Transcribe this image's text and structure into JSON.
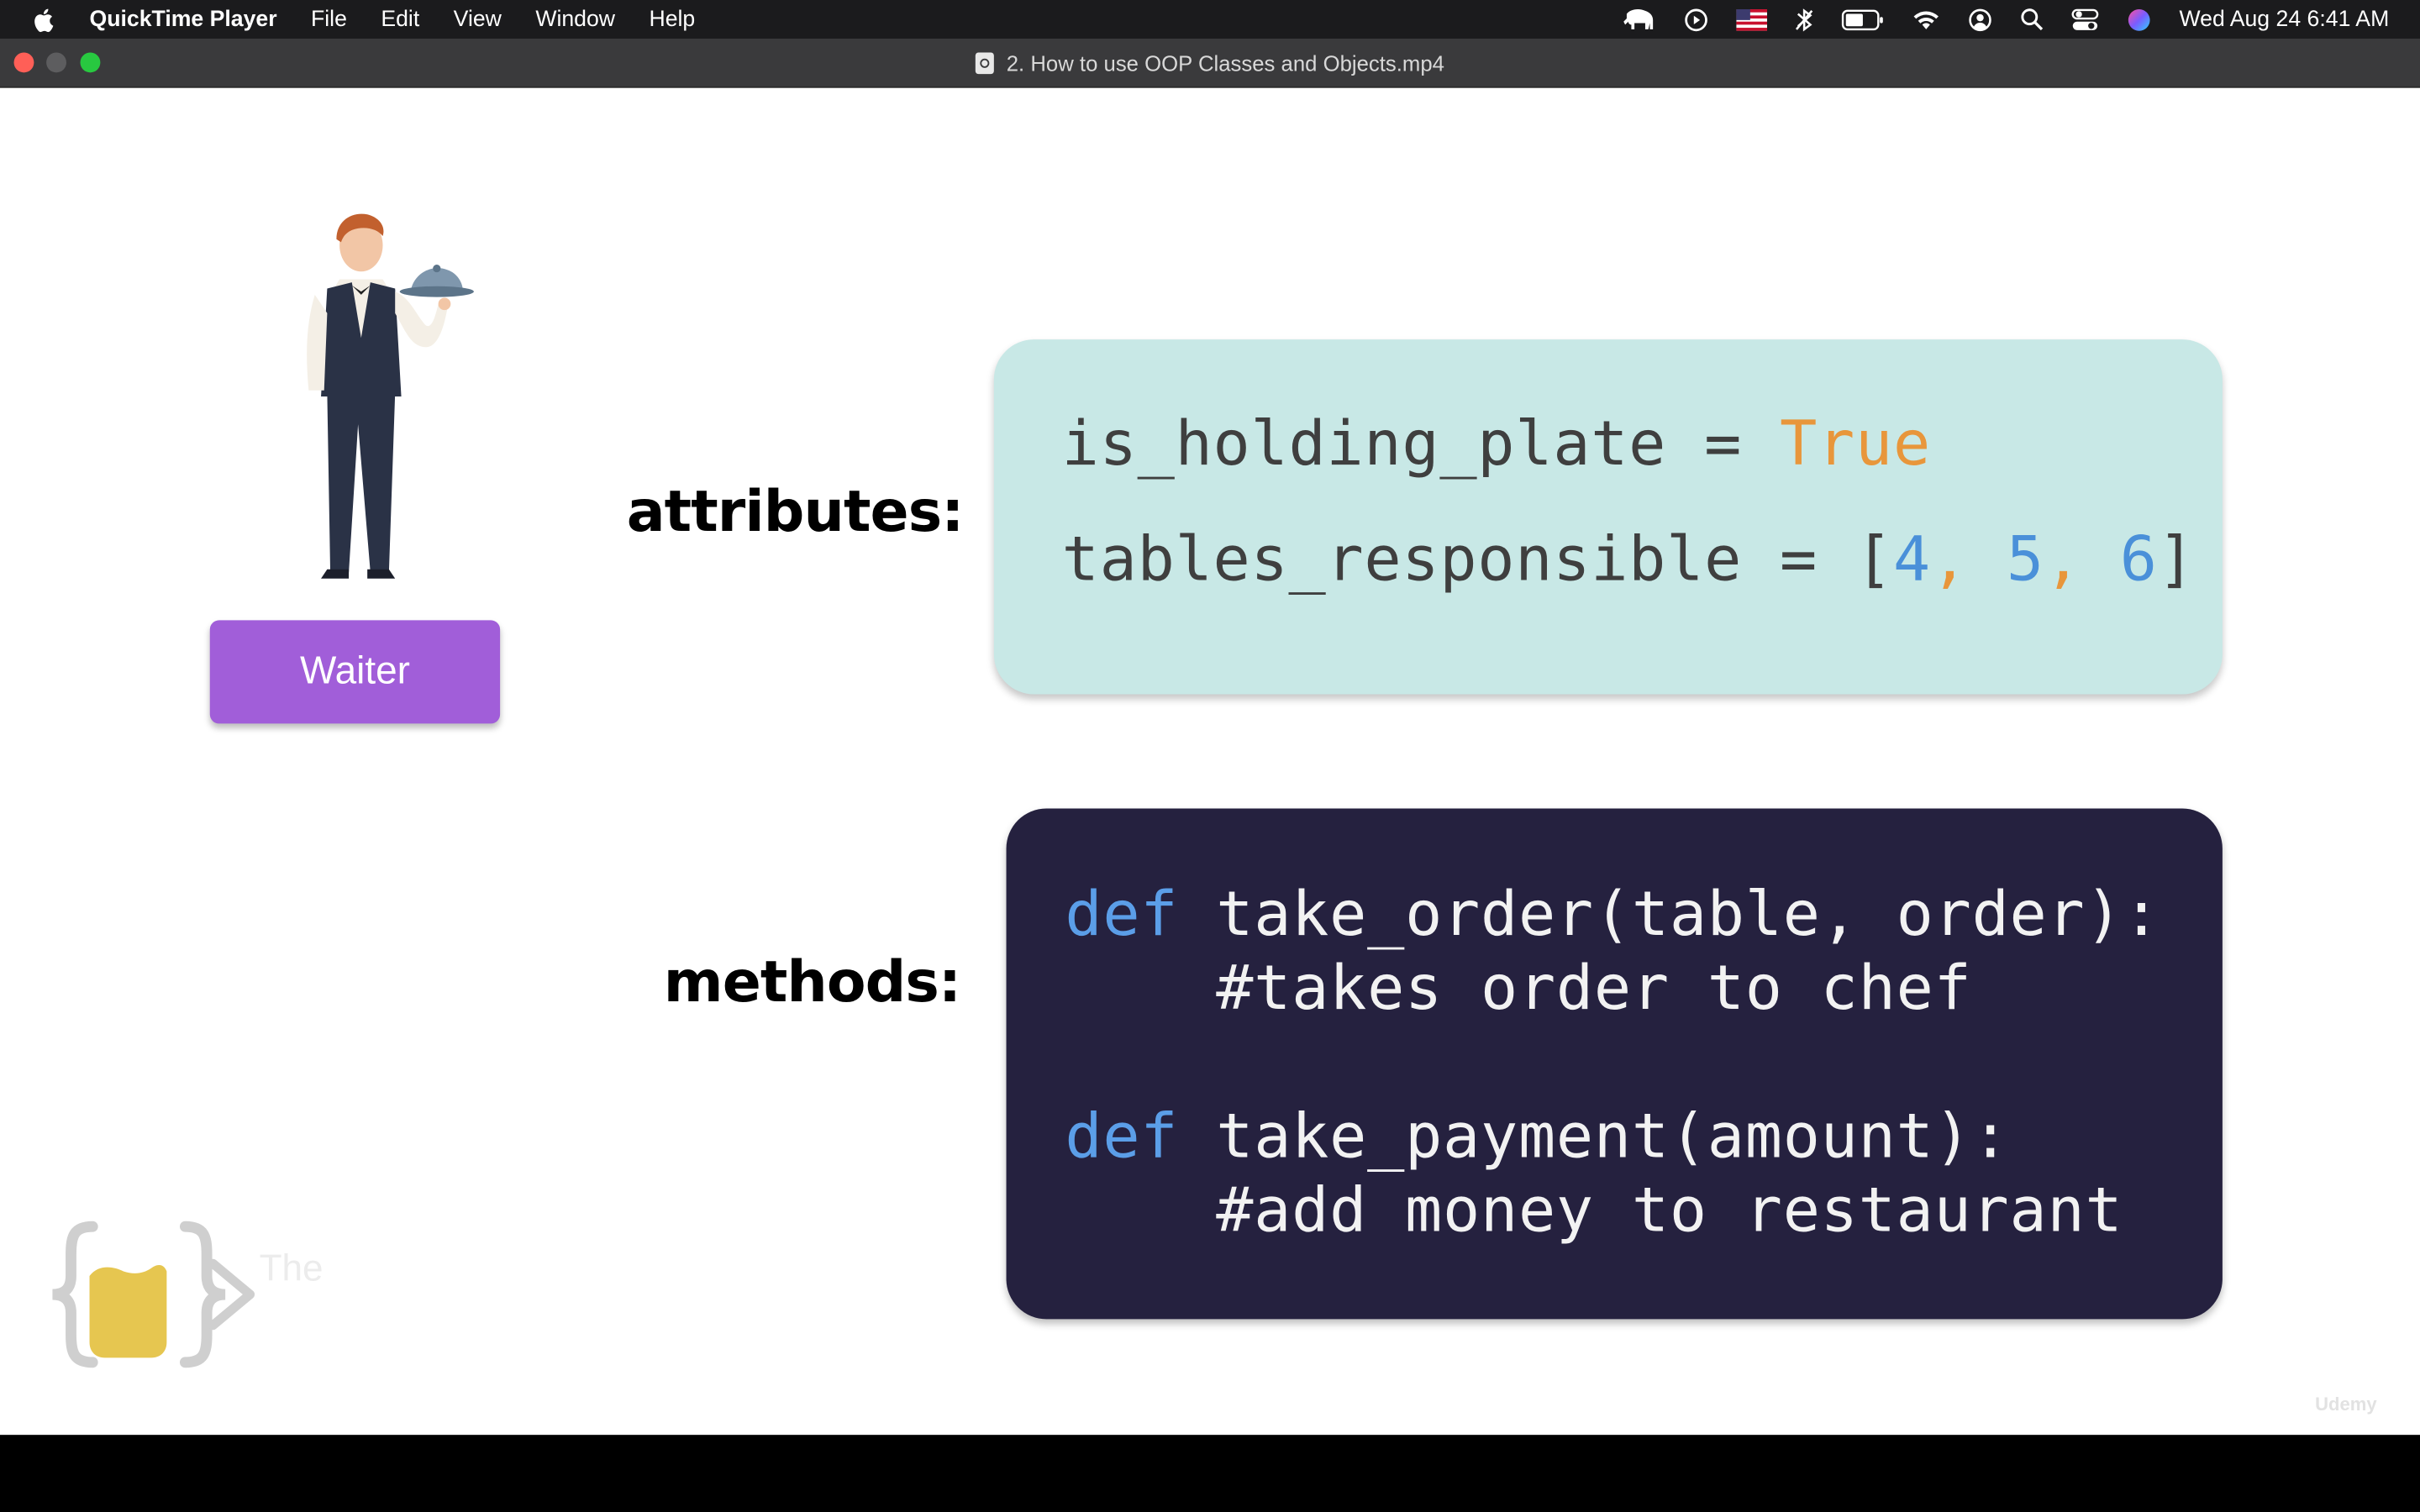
{
  "menubar": {
    "app_name": "QuickTime Player",
    "items": [
      "File",
      "Edit",
      "View",
      "Window",
      "Help"
    ],
    "status_icons": [
      "elephant-icon",
      "play-circle-icon",
      "us-flag-icon",
      "bluetooth-icon",
      "battery-icon",
      "wifi-icon",
      "user-icon",
      "search-icon",
      "control-center-icon",
      "siri-icon"
    ],
    "clock": "Wed Aug 24  6:41 AM"
  },
  "window": {
    "title": "2. How to use OOP Classes and Objects.mp4"
  },
  "video": {
    "badge_label": "Waiter",
    "attributes_label": "attributes:",
    "methods_label": "methods:",
    "attributes": {
      "line1_name": "is_holding_plate = ",
      "line1_value": "True",
      "line2_name": "tables_responsible = [",
      "line2_values": [
        "4",
        "5",
        "6"
      ],
      "line2_close": "]"
    },
    "methods": {
      "def_keyword": "def",
      "method1_signature": " take_order(table, order):",
      "method1_comment": "    #takes order to chef",
      "method2_signature": " take_payment(amount):",
      "method2_comment": "    #add money to restaurant"
    },
    "logo_text": "The",
    "watermark": "Udemy"
  },
  "colors": {
    "menubar_bg": "#1b1b1d",
    "titlebar_bg": "#3a3a3c",
    "badge_bg": "#a15ed9",
    "attr_box_bg": "#c8e8e6",
    "method_box_bg": "#25213f",
    "keyword_blue": "#5b9ee8",
    "value_orange": "#e8963b"
  }
}
